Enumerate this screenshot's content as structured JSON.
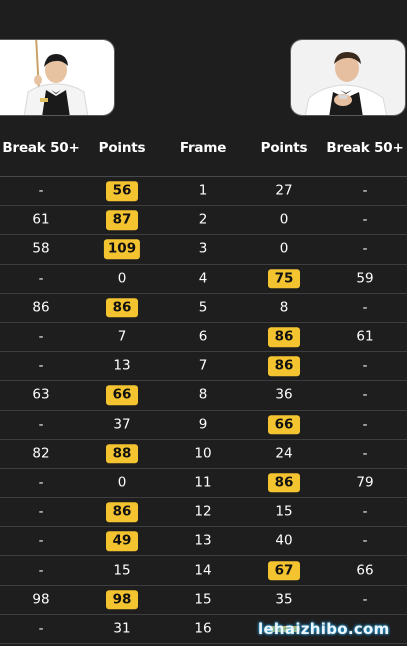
{
  "players": {
    "left": {
      "avatar_icon": "player-left-photo"
    },
    "right": {
      "avatar_icon": "player-right-photo"
    }
  },
  "table": {
    "headers": [
      "Break 50+",
      "Points",
      "Frame",
      "Points",
      "Break 50+"
    ],
    "rows": [
      {
        "lb": "-",
        "lp": "56",
        "lw": true,
        "frame": "1",
        "rp": "27",
        "rw": false,
        "rb": "-"
      },
      {
        "lb": "61",
        "lp": "87",
        "lw": true,
        "frame": "2",
        "rp": "0",
        "rw": false,
        "rb": "-"
      },
      {
        "lb": "58",
        "lp": "109",
        "lw": true,
        "frame": "3",
        "rp": "0",
        "rw": false,
        "rb": "-"
      },
      {
        "lb": "-",
        "lp": "0",
        "lw": false,
        "frame": "4",
        "rp": "75",
        "rw": true,
        "rb": "59"
      },
      {
        "lb": "86",
        "lp": "86",
        "lw": true,
        "frame": "5",
        "rp": "8",
        "rw": false,
        "rb": "-"
      },
      {
        "lb": "-",
        "lp": "7",
        "lw": false,
        "frame": "6",
        "rp": "86",
        "rw": true,
        "rb": "61"
      },
      {
        "lb": "-",
        "lp": "13",
        "lw": false,
        "frame": "7",
        "rp": "86",
        "rw": true,
        "rb": "-"
      },
      {
        "lb": "63",
        "lp": "66",
        "lw": true,
        "frame": "8",
        "rp": "36",
        "rw": false,
        "rb": "-"
      },
      {
        "lb": "-",
        "lp": "37",
        "lw": false,
        "frame": "9",
        "rp": "66",
        "rw": true,
        "rb": "-"
      },
      {
        "lb": "82",
        "lp": "88",
        "lw": true,
        "frame": "10",
        "rp": "24",
        "rw": false,
        "rb": "-"
      },
      {
        "lb": "-",
        "lp": "0",
        "lw": false,
        "frame": "11",
        "rp": "86",
        "rw": true,
        "rb": "79"
      },
      {
        "lb": "-",
        "lp": "86",
        "lw": true,
        "frame": "12",
        "rp": "15",
        "rw": false,
        "rb": "-"
      },
      {
        "lb": "-",
        "lp": "49",
        "lw": true,
        "frame": "13",
        "rp": "40",
        "rw": false,
        "rb": "-"
      },
      {
        "lb": "-",
        "lp": "15",
        "lw": false,
        "frame": "14",
        "rp": "67",
        "rw": true,
        "rb": "66"
      },
      {
        "lb": "98",
        "lp": "98",
        "lw": true,
        "frame": "15",
        "rp": "35",
        "rw": false,
        "rb": "-"
      },
      {
        "lb": "-",
        "lp": "31",
        "lw": false,
        "frame": "16",
        "rp": "",
        "rw": true,
        "rb": "-"
      }
    ]
  },
  "watermark": "lehaizhibo.com",
  "colors": {
    "background": "#1e1e1f",
    "winner_badge": "#f4c430",
    "row_divider": "#3e3e40"
  }
}
